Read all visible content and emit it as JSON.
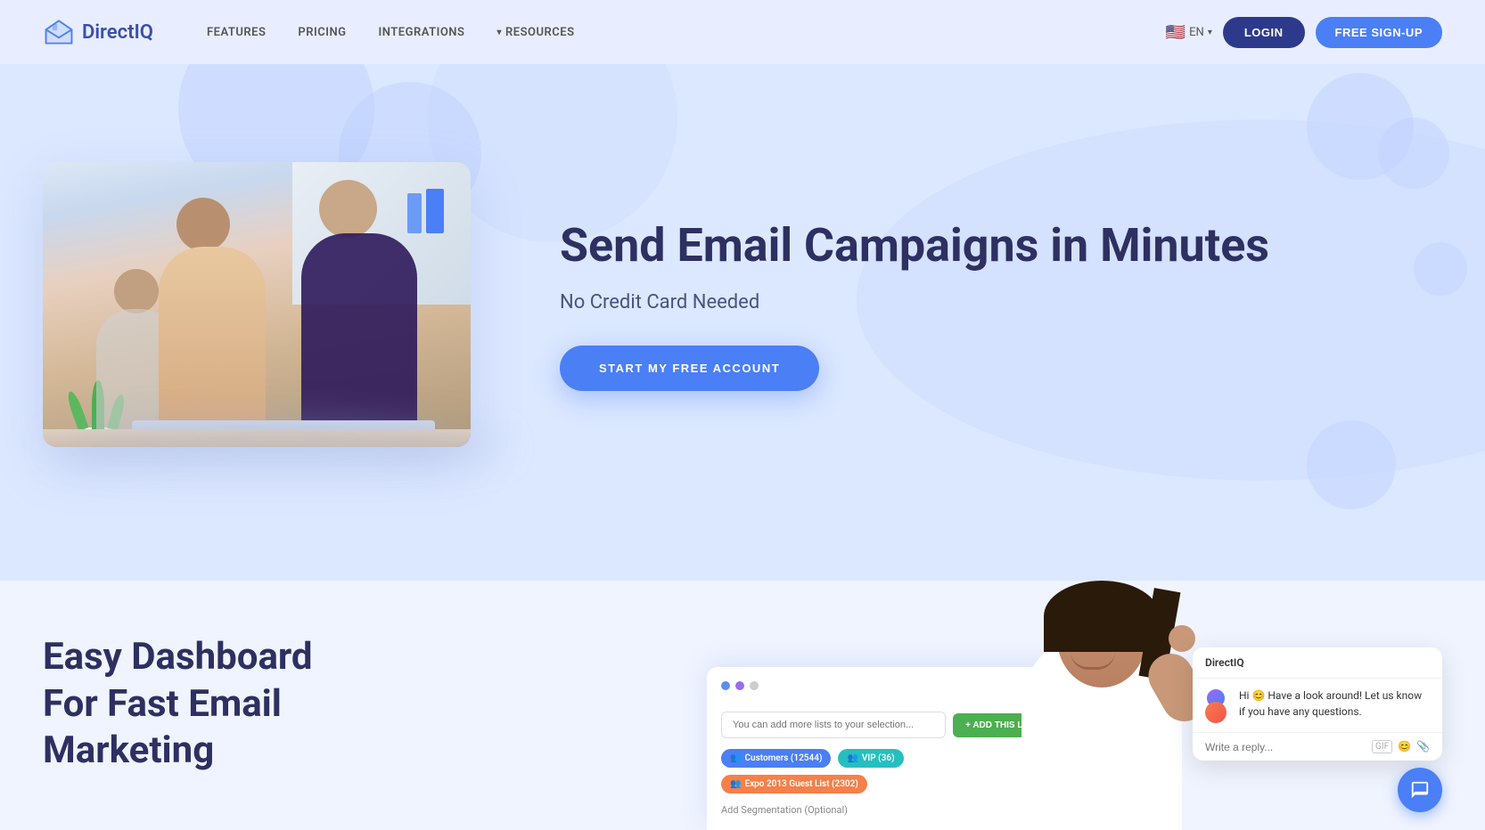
{
  "brand": {
    "name": "DirectIQ",
    "logo_alt": "DirectIQ logo"
  },
  "nav": {
    "links": [
      {
        "label": "FEATURES",
        "href": "#"
      },
      {
        "label": "PRICING",
        "href": "#"
      },
      {
        "label": "INTEGRATIONS",
        "href": "#"
      },
      {
        "label": "RESOURCES",
        "href": "#",
        "has_dropdown": true
      }
    ],
    "login_label": "LOGIN",
    "signup_label": "FREE SIGN-UP",
    "lang": "EN",
    "lang_flag": "🇺🇸"
  },
  "hero": {
    "title": "Send Email Campaigns in Minutes",
    "subtitle": "No Credit Card Needed",
    "cta_label": "START MY FREE ACCOUNT"
  },
  "lower": {
    "title": "Easy Dashboard For Fast Email Marketing"
  },
  "dashboard": {
    "input_placeholder": "You can add more lists to your selection...",
    "add_btn_label": "+ ADD THIS LIST",
    "tags": [
      {
        "label": "Customers (12544)",
        "color": "tag-blue"
      },
      {
        "label": "VIP (36)",
        "color": "tag-teal"
      },
      {
        "label": "Expo 2013 Guest List (2302)",
        "color": "tag-orange"
      }
    ],
    "segmentation_label": "Add Segmentation (Optional)"
  },
  "chat": {
    "brand_name": "DirectIQ",
    "message": "Hi 😊 Have a look around! Let us know if you have any questions.",
    "input_placeholder": "Write a reply...",
    "actions": [
      "GIF",
      "😊",
      "📎"
    ]
  }
}
